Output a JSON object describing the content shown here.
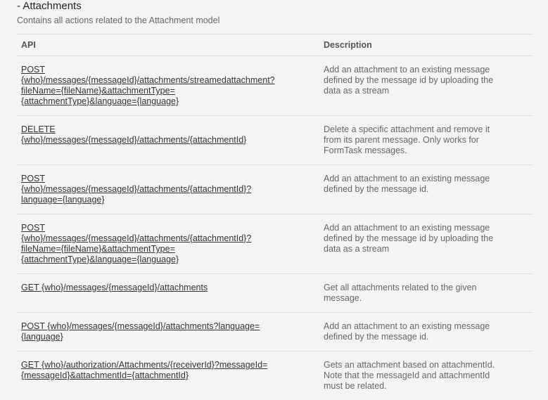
{
  "section": {
    "title": "- Attachments",
    "description": "Contains all actions related to the Attachment model"
  },
  "table": {
    "headers": {
      "api": "API",
      "description": "Description"
    },
    "rows": [
      {
        "api_lines": [
          "POST",
          "{who}/messages/{messageId}/attachments/streamedattachment?",
          "fileName={fileName}&attachmentType=",
          "{attachmentType}&language={language}"
        ],
        "desc_lines": [
          "Add an attachment to an existing message",
          "defined by the message id by uploading the",
          "data as a stream"
        ]
      },
      {
        "api_lines": [
          "DELETE",
          "{who}/messages/{messageId}/attachments/{attachmentId}"
        ],
        "desc_lines": [
          "Delete a specific attachment and remove it",
          "from its parent message. Only works for",
          "FormTask messages."
        ]
      },
      {
        "api_lines": [
          "POST",
          "{who}/messages/{messageId}/attachments/{attachmentId}?",
          "language={language}"
        ],
        "desc_lines": [
          "Add an attachment to an existing message",
          "defined by the message id."
        ]
      },
      {
        "api_lines": [
          "POST",
          "{who}/messages/{messageId}/attachments/{attachmentId}?",
          "fileName={fileName}&attachmentType=",
          "{attachmentType}&language={language}"
        ],
        "desc_lines": [
          "Add an attachment to an existing message",
          "defined by the message id by uploading the",
          "data as a stream"
        ]
      },
      {
        "api_lines": [
          "GET {who}/messages/{messageId}/attachments"
        ],
        "desc_lines": [
          "Get all attachments related to the given",
          "message."
        ]
      },
      {
        "api_lines": [
          "POST {who}/messages/{messageId}/attachments?language=",
          "{language}"
        ],
        "desc_lines": [
          "Add an attachment to an existing message",
          "defined by the message id."
        ]
      },
      {
        "api_lines": [
          "GET {who}/authorization/Attachments/{receiverId}?messageId=",
          "{messageId}&attachmentId={attachmentId}"
        ],
        "desc_lines": [
          "Gets an attachment based on attachmentId.",
          "Note that the messageId and attachmentId",
          "must be related."
        ]
      }
    ]
  }
}
